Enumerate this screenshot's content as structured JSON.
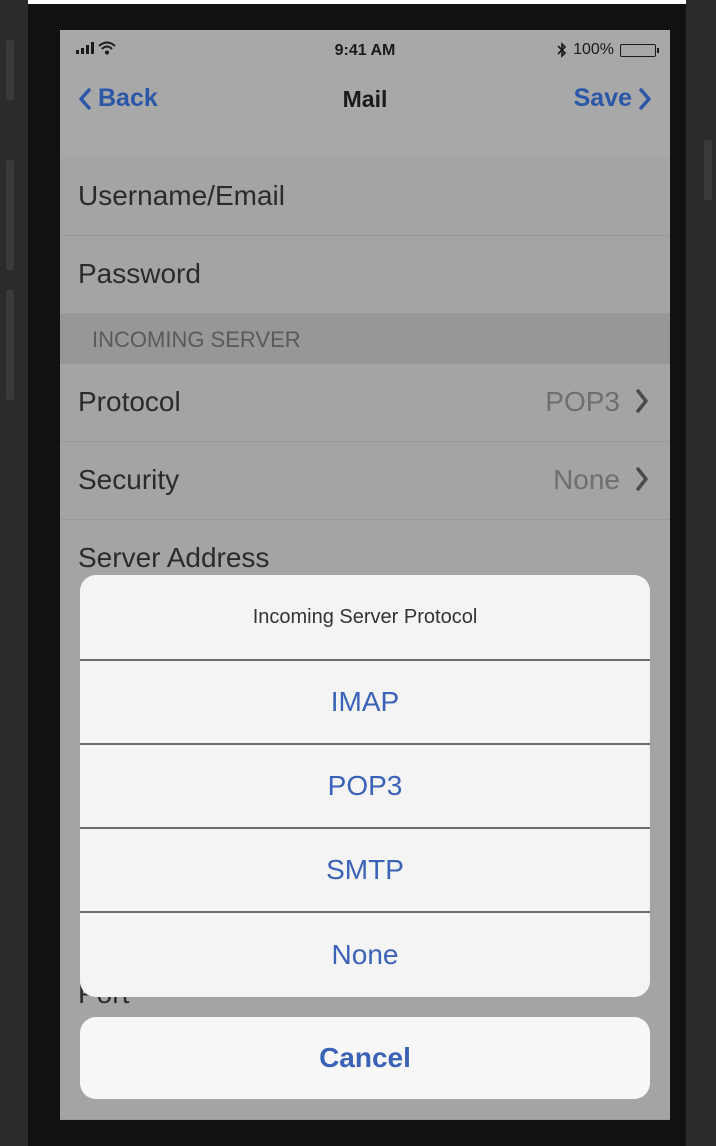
{
  "status_bar": {
    "time": "9:41 AM",
    "battery_text": "100%",
    "battery_level": 1.0,
    "icons": [
      "signal-icon",
      "wifi-icon",
      "bluetooth-icon",
      "battery-icon"
    ]
  },
  "nav": {
    "back_label": "Back",
    "title": "Mail",
    "save_label": "Save"
  },
  "form": {
    "username_label": "Username/Email",
    "password_label": "Password",
    "incoming_section": "INCOMING SERVER",
    "protocol_label": "Protocol",
    "protocol_value": "POP3",
    "security_label": "Security",
    "security_value": "None",
    "server_address_label": "Server Address",
    "port_label": "Port"
  },
  "action_sheet": {
    "title": "Incoming Server Protocol",
    "options": [
      "IMAP",
      "POP3",
      "SMTP",
      "None"
    ],
    "cancel_label": "Cancel"
  },
  "colors": {
    "accent": "#3a63b8",
    "nav_accent": "#2a57a8",
    "dim_background": "#a8a8a8",
    "sheet_background": "#f4f4f4"
  }
}
